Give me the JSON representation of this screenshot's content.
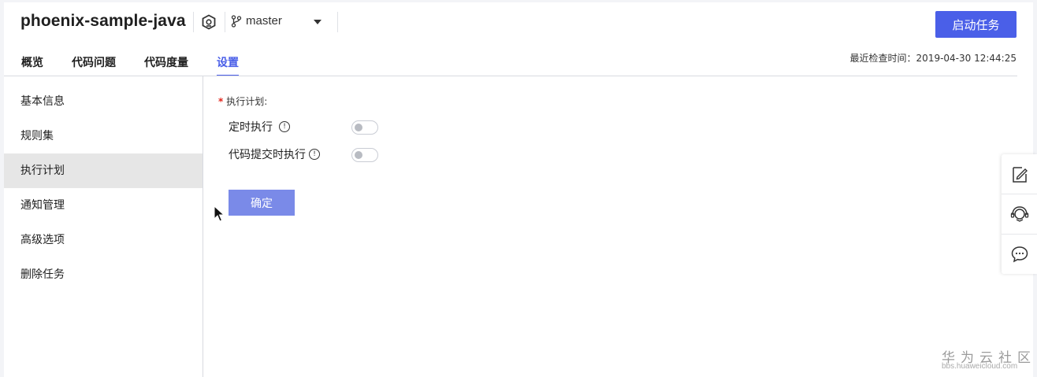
{
  "header": {
    "repo_name": "phoenix-sample-java",
    "branch": "master",
    "start_button": "启动任务",
    "check_time": "最近检查时间：2019-04-30 12:44:25"
  },
  "tabs": [
    {
      "label": "概览"
    },
    {
      "label": "代码问题"
    },
    {
      "label": "代码度量"
    },
    {
      "label": "设置",
      "active": true
    }
  ],
  "sidebar": {
    "items": [
      {
        "label": "基本信息"
      },
      {
        "label": "规则集"
      },
      {
        "label": "执行计划",
        "active": true
      },
      {
        "label": "通知管理"
      },
      {
        "label": "高级选项"
      },
      {
        "label": "删除任务"
      }
    ]
  },
  "plan": {
    "required_mark": "*",
    "label": "执行计划:",
    "options": [
      {
        "label": "定时执行",
        "enabled": false
      },
      {
        "label": "代码提交时执行",
        "enabled": false
      }
    ],
    "info_glyph": "!",
    "confirm_button": "确定"
  },
  "float_panel": {
    "icons": [
      "edit-note-icon",
      "support-headset-icon",
      "chat-bubble-icon"
    ]
  },
  "watermark": {
    "title": "华为云社区",
    "url": "bbs.huaweicloud.com"
  },
  "colors": {
    "accent": "#4a5fe8",
    "confirm_button": "#7a8ae8",
    "required": "#e2231a",
    "sidebar_active_bg": "#e6e6e6"
  }
}
